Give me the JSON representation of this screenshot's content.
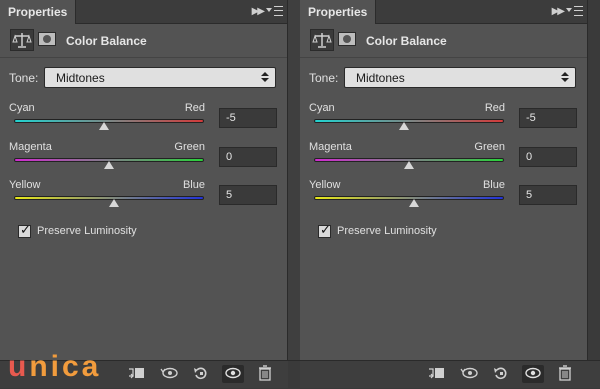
{
  "panels": [
    {
      "tab": "Properties",
      "title": "Color Balance",
      "tone": {
        "label": "Tone:",
        "value": "Midtones"
      },
      "sliders": [
        {
          "left": "Cyan",
          "right": "Red",
          "value": "-5",
          "level": -5,
          "gradient": [
            "#22d3d0",
            "#d23a3a"
          ]
        },
        {
          "left": "Magenta",
          "right": "Green",
          "value": "0",
          "level": 0,
          "gradient": [
            "#d02cd0",
            "#2ad13a"
          ]
        },
        {
          "left": "Yellow",
          "right": "Blue",
          "value": "5",
          "level": 5,
          "gradient": [
            "#e8e81a",
            "#2233d8"
          ]
        }
      ],
      "checkbox": {
        "label": "Preserve Luminosity",
        "checked": true
      }
    },
    {
      "tab": "Properties",
      "title": "Color Balance",
      "tone": {
        "label": "Tone:",
        "value": "Midtones"
      },
      "sliders": [
        {
          "left": "Cyan",
          "right": "Red",
          "value": "-5",
          "level": -5,
          "gradient": [
            "#22d3d0",
            "#d23a3a"
          ]
        },
        {
          "left": "Magenta",
          "right": "Green",
          "value": "0",
          "level": 0,
          "gradient": [
            "#d02cd0",
            "#2ad13a"
          ]
        },
        {
          "left": "Yellow",
          "right": "Blue",
          "value": "5",
          "level": 5,
          "gradient": [
            "#e8e81a",
            "#2233d8"
          ]
        }
      ],
      "checkbox": {
        "label": "Preserve Luminosity",
        "checked": true
      }
    }
  ],
  "slider_range": [
    -100,
    100
  ],
  "footer_icons": [
    "clip-to-layer-icon",
    "view-previous-icon",
    "reset-icon",
    "visibility-icon",
    "delete-icon"
  ],
  "logo": {
    "first": "u",
    "rest": "nica"
  },
  "colors": {
    "panel_bg": "#535353",
    "field_bg": "#3a3a3a",
    "select_bg": "#e0e0e0"
  }
}
